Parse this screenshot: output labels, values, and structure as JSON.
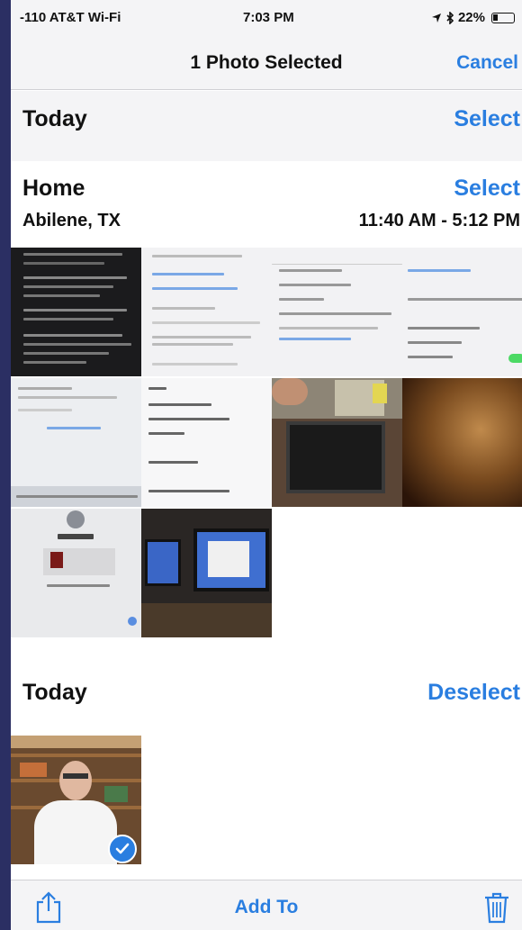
{
  "status_bar": {
    "carrier": "-110 AT&T Wi-Fi",
    "time": "7:03 PM",
    "battery": "22%"
  },
  "nav": {
    "title": "1 Photo Selected",
    "cancel": "Cancel"
  },
  "sections": {
    "today_top": {
      "title": "Today",
      "action": "Select"
    },
    "home": {
      "title": "Home",
      "action": "Select",
      "location": "Abilene, TX",
      "time_range": "11:40 AM - 5:12 PM"
    },
    "today_bottom": {
      "title": "Today",
      "action": "Deselect"
    }
  },
  "toolbar": {
    "add_to": "Add To",
    "share_icon": "share-icon",
    "trash_icon": "trash-icon"
  },
  "colors": {
    "accent": "#2a7ee0",
    "frame": "#2b2f63",
    "bar": "#f4f4f6"
  }
}
